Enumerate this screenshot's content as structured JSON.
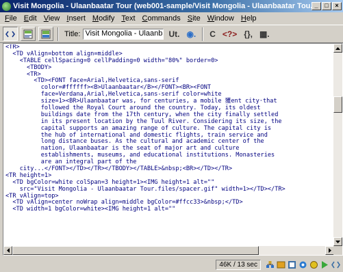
{
  "window": {
    "title": "Visit Mongolia - Ulaanbaatar Tour (web001-sample/Visit Mongolia - Ulaanbaatar Tou...",
    "minimize_glyph": "_",
    "maximize_glyph": "□",
    "close_glyph": "×"
  },
  "menu": {
    "items": [
      {
        "key": "F",
        "rest": "ile"
      },
      {
        "key": "E",
        "rest": "dit"
      },
      {
        "key": "V",
        "rest": "iew"
      },
      {
        "key": "I",
        "rest": "nsert"
      },
      {
        "key": "M",
        "rest": "odify"
      },
      {
        "key": "T",
        "rest": "ext"
      },
      {
        "key": "C",
        "rest": "ommands"
      },
      {
        "key": "S",
        "rest": "ite"
      },
      {
        "key": "W",
        "rest": "indow"
      },
      {
        "key": "H",
        "rest": "elp"
      }
    ]
  },
  "toolbar": {
    "title_label": "Title:",
    "title_value": "Visit Mongolia - Ulaanbaatar T",
    "icons": [
      "code-view-icon",
      "split-view-icon",
      "design-view-icon",
      "file-management-icon",
      "preview-icon",
      "refresh-icon",
      "code-navigation-icon",
      "braces-icon",
      "view-options-icon"
    ],
    "glyphs": {
      "file_management": "Ut.",
      "preview": "◉.",
      "refresh": "C",
      "code_nav": "<?>",
      "braces": "{},",
      "view_options": "▦."
    }
  },
  "code_lines": [
    "<TR>",
    "  <TD vAlign=bottom align=middle>",
    "    <TABLE cellSpacing=0 cellPadding=0 width=\"80%\" border=0>",
    "      <TBODY>",
    "      <TR>",
    "        <TD><FONT face=Arial,Helvetica,sans-serif",
    "          color=#ffffff><B>Ulaanbaatar</B></FONT><BR><FONT",
    "          face=Verdana,Arial,Helvetica,sans-serif color=white",
    "          size=1><BR>Ulaanbaatar was, for centuries, a mobile 獲ent city·that",
    "          followed the Royal Court around the country. Today, its oldest",
    "          buildings date from the 17th century, when the city finally settled",
    "          in its present location by the Tuul River. Considering its size, the",
    "          capital supports an amazing range of culture. The capital city is",
    "          the hub of international and domestic flights, train service and",
    "          long distance buses. As the cultural and academic center of the",
    "          nation, Ulaanbaatar is the seat of major art and culture",
    "          establishments, museums, and educational institutions. Monasteries",
    "          are an integral part of the",
    "    city...</FONT></TD></TR></TBODY></TABLE>&nbsp;<BR></TD></TR>",
    "<TR height=1>",
    "  <TD bgColor=white colSpan=3 height=1><IMG height=1 alt=\"\"",
    "    src=\"Visit Mongolia - Ulaanbaatar Tour.files/spacer.gif\" width=1></TD></TR>",
    "<TR vAlign=top>",
    "  <TD vAlign=center noWrap align=middle bgColor=#ffcc33>&nbsp;</TD>",
    "  <TD width=1 bgColor=white><IMG height=1 alt=\"\""
  ],
  "status": {
    "size_text": "46K / 13 sec"
  },
  "colors": {
    "titlebar_start": "#0a246a",
    "code_text": "#000080",
    "chrome": "#d4d0c8"
  }
}
